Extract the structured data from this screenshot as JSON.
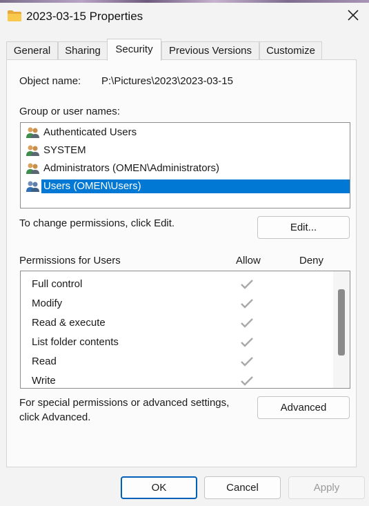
{
  "window": {
    "title": "2023-03-15 Properties",
    "title_icon": "folder-icon",
    "close_icon": "close-icon"
  },
  "tabs": [
    {
      "label": "General",
      "active": false
    },
    {
      "label": "Sharing",
      "active": false
    },
    {
      "label": "Security",
      "active": true
    },
    {
      "label": "Previous Versions",
      "active": false
    },
    {
      "label": "Customize",
      "active": false
    }
  ],
  "security": {
    "object_name_label": "Object name:",
    "object_name_value": "P:\\Pictures\\2023\\2023-03-15",
    "group_label": "Group or user names:",
    "users": [
      {
        "name": "Authenticated Users",
        "icon": "users-group-icon",
        "selected": false
      },
      {
        "name": "SYSTEM",
        "icon": "users-group-icon",
        "selected": false
      },
      {
        "name": "Administrators (OMEN\\Administrators)",
        "icon": "users-group-icon",
        "selected": false
      },
      {
        "name": "Users (OMEN\\Users)",
        "icon": "users-group-icon",
        "selected": true
      }
    ],
    "change_hint": "To change permissions, click Edit.",
    "edit_button": "Edit...",
    "permissions_label": "Permissions for Users",
    "allow_header": "Allow",
    "deny_header": "Deny",
    "permissions": [
      {
        "name": "Full control",
        "allow": true,
        "deny": false
      },
      {
        "name": "Modify",
        "allow": true,
        "deny": false
      },
      {
        "name": "Read & execute",
        "allow": true,
        "deny": false
      },
      {
        "name": "List folder contents",
        "allow": true,
        "deny": false
      },
      {
        "name": "Read",
        "allow": true,
        "deny": false
      },
      {
        "name": "Write",
        "allow": true,
        "deny": false
      }
    ],
    "advanced_hint_line1": "For special permissions or advanced settings,",
    "advanced_hint_line2": "click Advanced.",
    "advanced_button": "Advanced"
  },
  "footer": {
    "ok": "OK",
    "cancel": "Cancel",
    "apply": "Apply",
    "apply_enabled": false
  },
  "colors": {
    "selection": "#0078d4",
    "default_button_border": "#005fb8",
    "check_gray": "#a8a8a8"
  }
}
